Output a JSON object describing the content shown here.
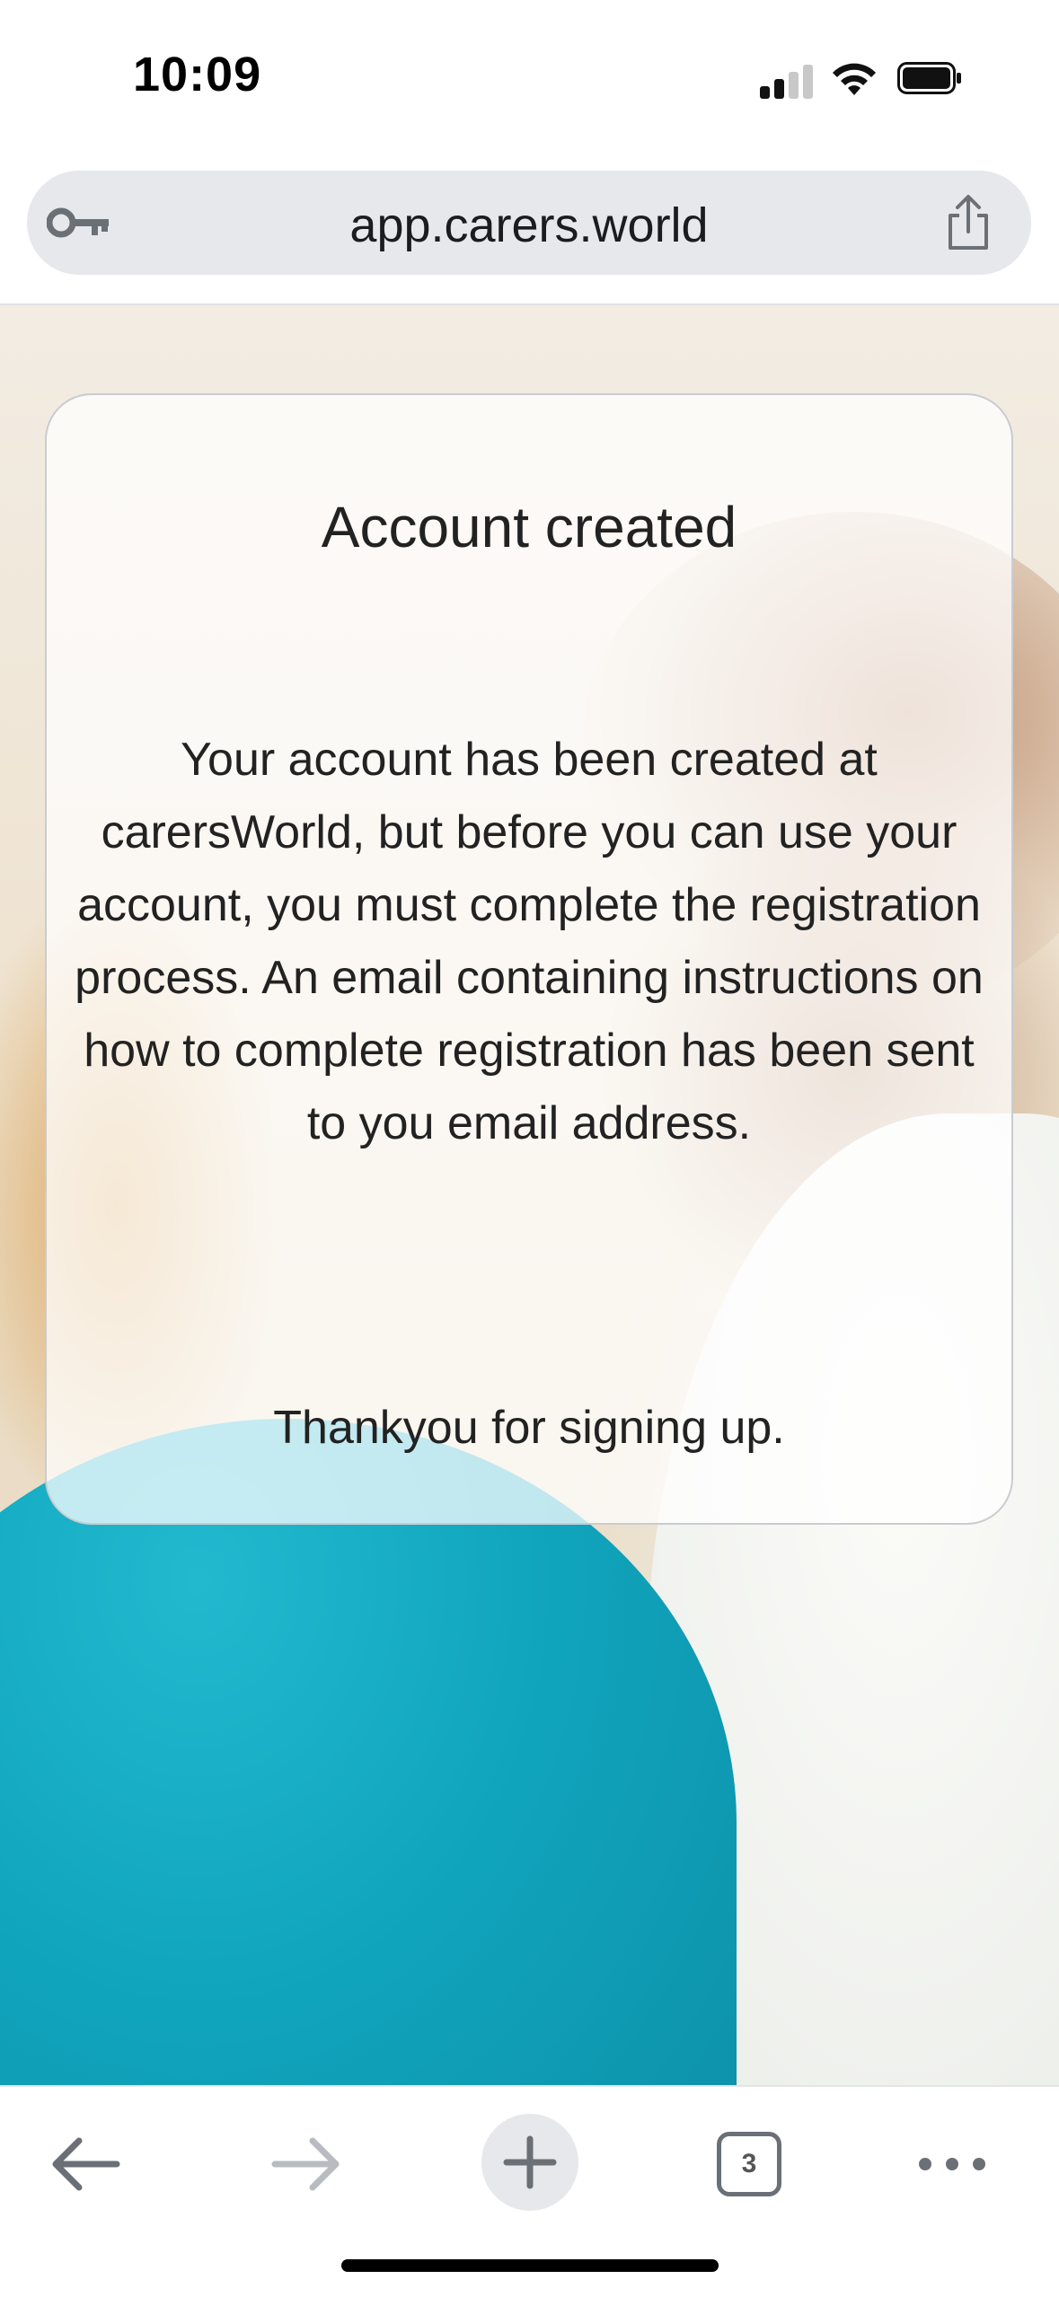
{
  "status_bar": {
    "time": "10:09"
  },
  "browser": {
    "url": "app.carers.world",
    "tab_count": "3"
  },
  "card": {
    "title": "Account created",
    "body": "Your account has been created at carersWorld, but before you can use your account, you must complete the registration process. An email containing instructions on how to complete registration has been sent to you email address.",
    "thanks": "Thankyou for signing up."
  },
  "icons": {
    "key": "key-icon",
    "share": "share-icon",
    "back": "arrow-left-icon",
    "forward": "arrow-right-icon",
    "new_tab": "plus-icon",
    "tabs": "tabs-count-icon",
    "more": "more-horizontal-icon"
  },
  "colors": {
    "url_bar_bg": "#e6e8eb",
    "toolbar_icon": "#6b6f76",
    "forward_disabled": "#b8bbc0"
  }
}
